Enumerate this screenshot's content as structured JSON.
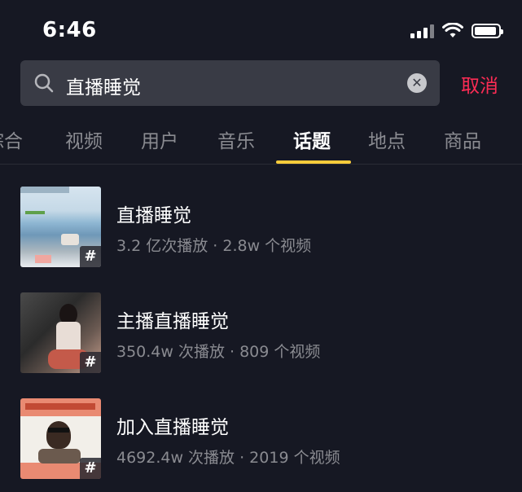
{
  "status_bar": {
    "time": "6:46"
  },
  "search": {
    "query": "直播睡觉",
    "cancel_label": "取消"
  },
  "tabs": [
    {
      "label": "综合"
    },
    {
      "label": "视频"
    },
    {
      "label": "用户"
    },
    {
      "label": "音乐"
    },
    {
      "label": "话题",
      "active": true
    },
    {
      "label": "地点"
    },
    {
      "label": "商品"
    }
  ],
  "topics": [
    {
      "title": "直播睡觉",
      "meta": "3.2 亿次播放 · 2.8w 个视频",
      "thumb_desc": "game-screenshot",
      "badge": "#"
    },
    {
      "title": "主播直播睡觉",
      "meta": "350.4w 次播放 · 809 个视频",
      "thumb_desc": "person-photo",
      "badge": "#"
    },
    {
      "title": "加入直播睡觉",
      "meta": "4692.4w 次播放 · 2019 个视频",
      "thumb_desc": "person-with-sunglasses",
      "badge": "#"
    }
  ],
  "colors": {
    "background": "#161823",
    "accent": "#fe2c55",
    "tab_indicator": "#facc3b",
    "secondary_text": "#8a8b91"
  }
}
